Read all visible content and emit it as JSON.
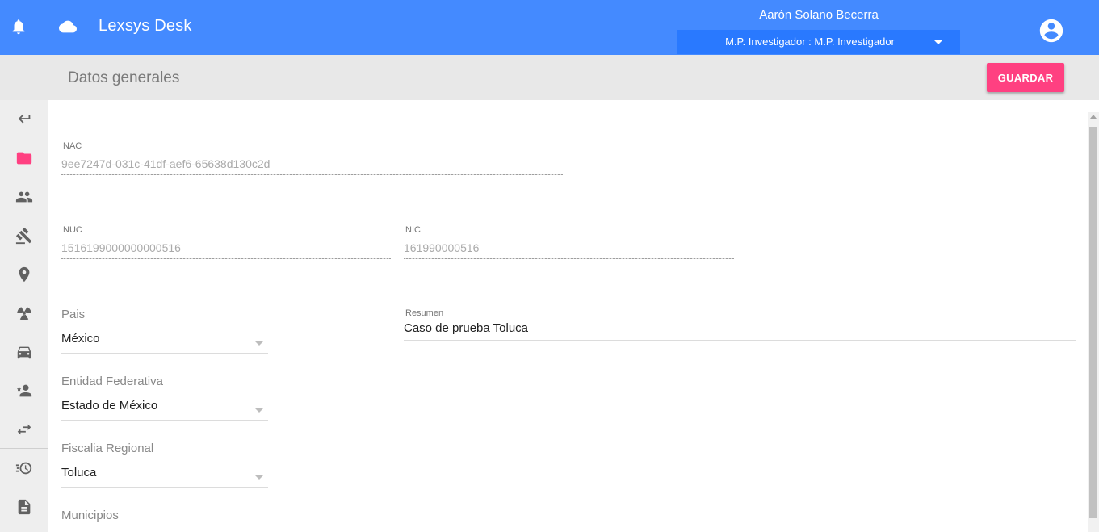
{
  "header": {
    "app_title": "Lexsys Desk",
    "user_name": "Aarón Solano Becerra",
    "role": "M.P. Investigador : M.P. Investigador",
    "icons": [
      "bell-icon",
      "cloud-icon",
      "account-circle-icon"
    ],
    "color": "#448aff"
  },
  "subheader": {
    "page_title": "Datos generales",
    "save_label": "GUARDAR",
    "save_color": "#ff4081"
  },
  "sidebar": {
    "items": [
      {
        "icon": "back-arrow-icon"
      },
      {
        "icon": "folder-icon",
        "active": true
      },
      {
        "icon": "people-icon"
      },
      {
        "icon": "gavel-icon"
      },
      {
        "icon": "location-pin-icon"
      },
      {
        "icon": "radioactive-icon"
      },
      {
        "icon": "car-icon"
      },
      {
        "icon": "person-star-icon"
      },
      {
        "icon": "swap-arrows-icon"
      },
      {
        "icon": "history-icon"
      },
      {
        "icon": "document-icon"
      }
    ]
  },
  "form": {
    "nac": {
      "label": "NAC",
      "value": "9ee7247d-031c-41df-aef6-65638d130c2d"
    },
    "nuc": {
      "label": "NUC",
      "value": "1516199000000000516"
    },
    "nic": {
      "label": "NIC",
      "value": "161990000516"
    },
    "pais": {
      "label": "Pais",
      "value": "México"
    },
    "entidad": {
      "label": "Entidad Federativa",
      "value": "Estado de México"
    },
    "fiscalia": {
      "label": "Fiscalia Regional",
      "value": "Toluca"
    },
    "municipios": {
      "label": "Municipios"
    },
    "resumen": {
      "label": "Resumen",
      "value": "Caso de prueba Toluca"
    }
  }
}
